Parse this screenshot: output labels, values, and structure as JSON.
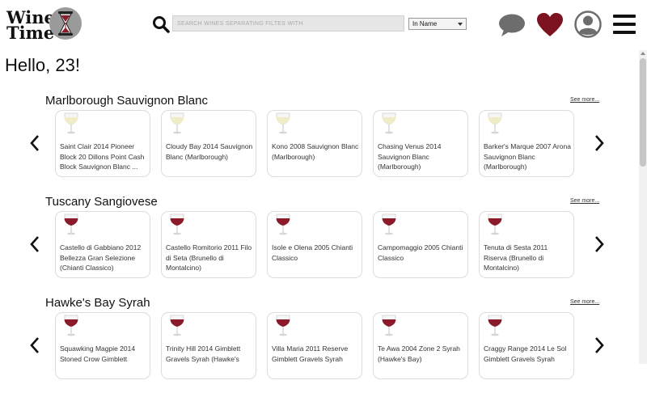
{
  "app": {
    "logo_line1": "Wine",
    "logo_line2": "Time"
  },
  "search": {
    "placeholder": "SEARCH WINES SEPARATING FILTES WITH",
    "value": "",
    "filter_selected": "In Name"
  },
  "greeting": "Hello, 23!",
  "colors": {
    "red_wine": "#8b1a2b",
    "white_wine": "#f0ecc8",
    "heart": "#7d1220"
  },
  "sections": [
    {
      "title": "Marlborough Sauvignon Blanc",
      "see_more": "See more...",
      "wine_type": "white",
      "cards": [
        {
          "name": "Saint Clair 2014 Pioneer Block 20 Dillons Point Cash Block Sauvignon Blanc ..."
        },
        {
          "name": "Cloudy Bay 2014 Sauvignon Blanc (Marlborough)"
        },
        {
          "name": "Kono 2008 Sauvignon Blanc (Marlborough)"
        },
        {
          "name": "Chasing Venus 2014 Sauvignon Blanc (Marlborough)"
        },
        {
          "name": "Barker's Marque 2007 Arona Sauvignon Blanc (Marlborough)"
        }
      ]
    },
    {
      "title": "Tuscany Sangiovese",
      "see_more": "See more...",
      "wine_type": "red",
      "cards": [
        {
          "name": "Castello di Gabbiano 2012 Bellezza Gran Selezione (Chianti Classico)"
        },
        {
          "name": "Castello Romitorio 2011 Filo di Seta  (Brunello di Montalcino)"
        },
        {
          "name": "Isole e Olena 2005  Chianti Classico"
        },
        {
          "name": "Campomaggio 2005 Chianti Classico"
        },
        {
          "name": "Tenuta di Sesta 2011 Riserva  (Brunello di Montalcino)"
        }
      ]
    },
    {
      "title": "Hawke's Bay Syrah",
      "see_more": "See more...",
      "wine_type": "red",
      "cards": [
        {
          "name": "Squawking Magpie 2014 Stoned Crow Gimblett"
        },
        {
          "name": "Trinity Hill 2014 Gimblett Gravels Syrah (Hawke's"
        },
        {
          "name": "Villa Maria 2011 Reserve Gimblett Gravels Syrah"
        },
        {
          "name": "Te Awa 2004 Zone 2 Syrah (Hawke's Bay)"
        },
        {
          "name": "Craggy Range 2014 Le Sol Gimblett Gravels Syrah"
        }
      ]
    }
  ]
}
